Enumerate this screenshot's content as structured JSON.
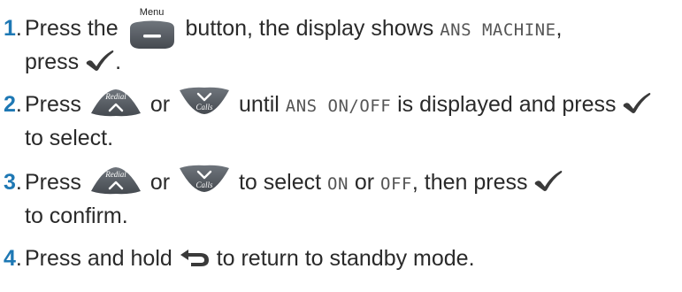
{
  "steps": [
    {
      "number": "1",
      "parts": [
        "Press the",
        "button, the display shows",
        "ANS MACHINE",
        ",",
        "press",
        "."
      ],
      "menu_button_label": "Menu",
      "menu_icon": "menu-minus-icon",
      "confirm_icon": "checkmark-icon"
    },
    {
      "number": "2",
      "parts": [
        "Press",
        "or",
        "until",
        "ANS ON/OFF",
        "is displayed and press",
        "to select."
      ],
      "redial_label": "Redial",
      "calls_label": "Calls",
      "up_icon": "redial-up-icon",
      "down_icon": "calls-down-icon"
    },
    {
      "number": "3",
      "parts": [
        "Press",
        "or",
        "to select",
        "ON",
        "or",
        "OFF",
        ", then press",
        "to confirm."
      ],
      "redial_label": "Redial",
      "calls_label": "Calls"
    },
    {
      "number": "4",
      "parts": [
        "Press and hold",
        "to return to standby mode."
      ],
      "back_icon": "back-arrow-icon"
    }
  ],
  "colors": {
    "step_number": "#1e78b4",
    "button_fill": "#5a6068",
    "text": "#2a2a2a"
  }
}
